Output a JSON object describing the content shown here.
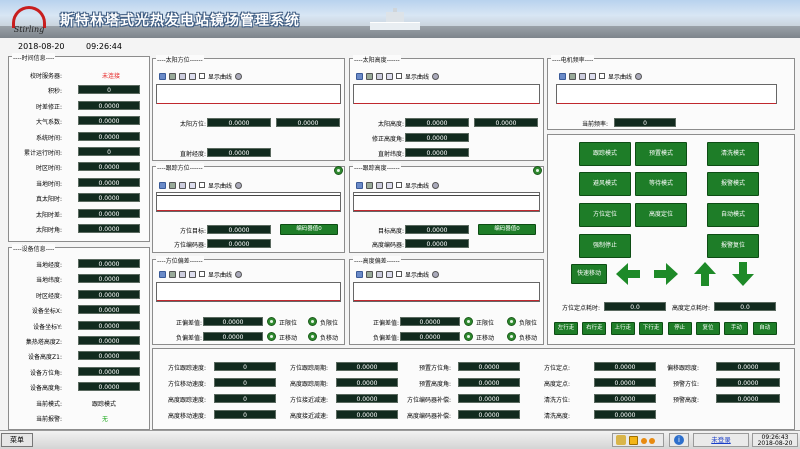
{
  "app": {
    "title": "斯特林塔式光热发电站镜场管理系统",
    "logo_text": "Stirling",
    "date": "2018-08-20",
    "time": "09:26:44"
  },
  "time_info": {
    "title": "时间信息",
    "rows": [
      {
        "label": "校时服务器:",
        "value": "未连接",
        "style": "red"
      },
      {
        "label": "积秒:",
        "value": "0"
      },
      {
        "label": "时差修正:",
        "value": "0.0000"
      },
      {
        "label": "大气系数:",
        "value": "0.0000"
      },
      {
        "label": "系统时间:",
        "value": "0.0000"
      },
      {
        "label": "累计运行时间:",
        "value": "0"
      },
      {
        "label": "时区时间:",
        "value": "0.0000"
      },
      {
        "label": "当地时间:",
        "value": "0.0000"
      },
      {
        "label": "真太阳时:",
        "value": "0.0000"
      },
      {
        "label": "太阳时差:",
        "value": "0.0000"
      },
      {
        "label": "太阳时角:",
        "value": "0.0000"
      }
    ]
  },
  "device_info": {
    "title": "设备信息",
    "rows": [
      {
        "label": "当地经度:",
        "value": "0.0000"
      },
      {
        "label": "当地纬度:",
        "value": "0.0000"
      },
      {
        "label": "时区经度:",
        "value": "0.0000"
      },
      {
        "label": "设备坐标X:",
        "value": "0.0000"
      },
      {
        "label": "设备坐标Y:",
        "value": "0.0000"
      },
      {
        "label": "集热塔高度Z:",
        "value": "0.0000"
      },
      {
        "label": "设备高度Z1:",
        "value": "0.0000"
      },
      {
        "label": "设备方位角:",
        "value": "0.0000"
      },
      {
        "label": "设备高度角:",
        "value": "0.0000"
      },
      {
        "label": "当前模式:",
        "value": "跟踪模式",
        "style": "plain"
      },
      {
        "label": "当前报警:",
        "value": "无",
        "style": "green"
      }
    ]
  },
  "toolbar": {
    "show_curve": "显示曲线"
  },
  "sun_azimuth": {
    "title": "太阳方位",
    "row1_label": "太阳方位:",
    "row1_v1": "0.0000",
    "row1_v2": "0.0000",
    "row2_label": "直射经度:",
    "row2_v": "0.0000"
  },
  "sun_altitude": {
    "title": "太阳高度",
    "r1_label": "太阳高度:",
    "r1_v1": "0.0000",
    "r1_v2": "0.0000",
    "r2_label": "修正高度角:",
    "r2_v": "0.0000",
    "r3_label": "直射纬度:",
    "r3_v": "0.0000"
  },
  "motor": {
    "title": "电机频率",
    "label": "当前频率:",
    "value": "0"
  },
  "track_azimuth": {
    "title": "跟踪方位",
    "r1_label": "方位目标:",
    "r1_v": "0.0000",
    "r1_btn": "编码器值0",
    "r2_label": "方位编码器:",
    "r2_v": "0.0000"
  },
  "track_altitude": {
    "title": "跟踪高度",
    "r1_label": "目标高度:",
    "r1_v": "0.0000",
    "r1_btn": "编码器值0",
    "r2_label": "高度编码器:",
    "r2_v": "0.0000"
  },
  "azimuth_dev": {
    "title": "方位偏差",
    "r1_label": "正偏差值:",
    "r1_v": "0.0000",
    "r1_a": "正限位",
    "r1_b": "负限位",
    "r2_label": "负偏差值:",
    "r2_v": "0.0000",
    "r2_a": "正移动",
    "r2_b": "负移动"
  },
  "altitude_dev": {
    "title": "高度偏差",
    "r1_label": "正偏差值:",
    "r1_v": "0.0000",
    "r1_a": "正限位",
    "r1_b": "负限位",
    "r2_label": "负偏差值:",
    "r2_v": "0.0000",
    "r2_a": "正移动",
    "r2_b": "负移动"
  },
  "modes": [
    "跟踪模式",
    "预置模式",
    "清洗模式",
    "避风模式",
    "等待模式",
    "报警模式",
    "方位定位",
    "高度定位",
    "自动模式",
    "强制停止",
    "报警复位"
  ],
  "quick_btn": "快速移动",
  "pos_time": {
    "l1": "方位定点耗时:",
    "v1": "0.0",
    "l2": "高度定点耗时:",
    "v2": "0.0"
  },
  "small_btns": [
    "左行走",
    "右行走",
    "上行走",
    "下行走",
    "停止",
    "复位",
    "手动",
    "自动"
  ],
  "bottom": {
    "c1": [
      {
        "l": "方位跟踪速度:",
        "v": "0"
      },
      {
        "l": "方位移动速度:",
        "v": "0"
      },
      {
        "l": "高度跟踪速度:",
        "v": "0"
      },
      {
        "l": "高度移动速度:",
        "v": "0"
      }
    ],
    "c2": [
      {
        "l": "方位跟踪周期:",
        "v": "0.0000"
      },
      {
        "l": "高度跟踪周期:",
        "v": "0.0000"
      },
      {
        "l": "方位接近减速:",
        "v": "0.0000"
      },
      {
        "l": "高度接近减速:",
        "v": "0.0000"
      }
    ],
    "c3": [
      {
        "l": "预置方位角:",
        "v": "0.0000"
      },
      {
        "l": "预置高度角:",
        "v": "0.0000"
      },
      {
        "l": "方位编码器补偿:",
        "v": "0.0000"
      },
      {
        "l": "高度编码器补偿:",
        "v": "0.0000"
      }
    ],
    "c4": [
      {
        "l": "方位定点:",
        "v": "0.0000"
      },
      {
        "l": "高度定点:",
        "v": "0.0000"
      },
      {
        "l": "清洗方位:",
        "v": "0.0000"
      },
      {
        "l": "清洗高度:",
        "v": "0.0000"
      }
    ],
    "c5": [
      {
        "l": "偏移跟踪度:",
        "v": "0.0000"
      },
      {
        "l": "预警方位:",
        "v": "0.0000"
      },
      {
        "l": "预警高度:",
        "v": "0.0000"
      }
    ]
  },
  "taskbar": {
    "menu": "菜单",
    "user": "未登录",
    "time": "09:26:43",
    "date": "2018-08-20"
  }
}
